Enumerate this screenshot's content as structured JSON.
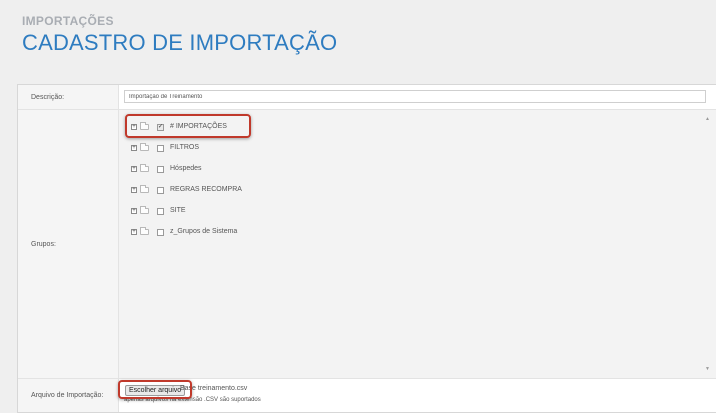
{
  "header": {
    "section": "IMPORTAÇÕES",
    "title": "CADASTRO DE IMPORTAÇÃO"
  },
  "form": {
    "description": {
      "label": "Descrição:",
      "value": "Importação de Treinamento"
    },
    "groups": {
      "label": "Grupos:",
      "items": [
        {
          "label": "# IMPORTAÇÕES",
          "checked": true
        },
        {
          "label": "FILTROS",
          "checked": false
        },
        {
          "label": "Hóspedes",
          "checked": false
        },
        {
          "label": "REGRAS RECOMPRA",
          "checked": false
        },
        {
          "label": "SITE",
          "checked": false
        },
        {
          "label": "z_Grupos de Sistema",
          "checked": false
        }
      ]
    },
    "file": {
      "label": "Arquivo de Importação:",
      "button_label": "Escolher arquivo",
      "selected_file": "Base treinamento.csv",
      "hint": "apenas arquivos na extensão .CSV são suportados"
    }
  },
  "colors": {
    "title": "#2e7cc0",
    "highlight": "#c0392b"
  },
  "icons": {
    "expander": "plus-box-icon",
    "folder": "folder-icon",
    "check": "checkmark-icon",
    "scroll_up": "arrow-up-icon",
    "scroll_down": "arrow-down-icon"
  }
}
